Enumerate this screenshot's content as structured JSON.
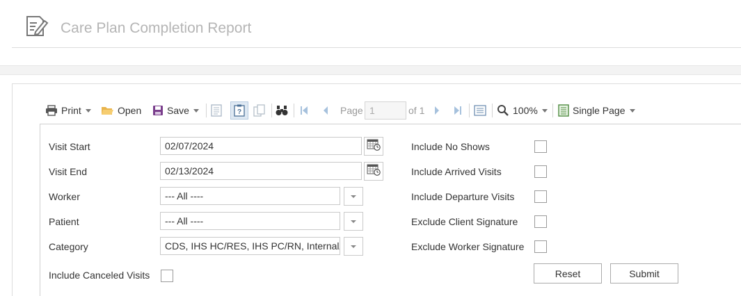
{
  "header": {
    "title": "Care Plan Completion Report",
    "icon": "report-edit-icon"
  },
  "toolbar": {
    "print_label": "Print",
    "open_label": "Open",
    "save_label": "Save",
    "page_label": "Page",
    "page_value": "1",
    "page_of": "of 1",
    "zoom_label": "100%",
    "view_mode_label": "Single Page",
    "icons": [
      "printer-icon",
      "folder-open-icon",
      "floppy-disk-icon",
      "document-map-icon",
      "parameters-icon",
      "copy-icon",
      "binoculars-icon",
      "first-page-icon",
      "previous-page-icon",
      "next-page-icon",
      "last-page-icon",
      "full-screen-icon",
      "magnifier-icon",
      "single-page-icon"
    ]
  },
  "form": {
    "visit_start_label": "Visit Start",
    "visit_start_value": "02/07/2024",
    "visit_end_label": "Visit End",
    "visit_end_value": "02/13/2024",
    "worker_label": "Worker",
    "worker_value": "--- All ----",
    "patient_label": "Patient",
    "patient_value": "--- All ----",
    "category_label": "Category",
    "category_value": "CDS, IHS HC/RES, IHS PC/RN, Internal/N",
    "include_canceled_label": "Include Canceled Visits",
    "include_no_shows_label": "Include No Shows",
    "include_arrived_label": "Include Arrived Visits",
    "include_departure_label": "Include Departure Visits",
    "exclude_client_sig_label": "Exclude Client Signature",
    "exclude_worker_sig_label": "Exclude Worker Signature",
    "checkboxes_checked": false,
    "reset_label": "Reset",
    "submit_label": "Submit"
  }
}
